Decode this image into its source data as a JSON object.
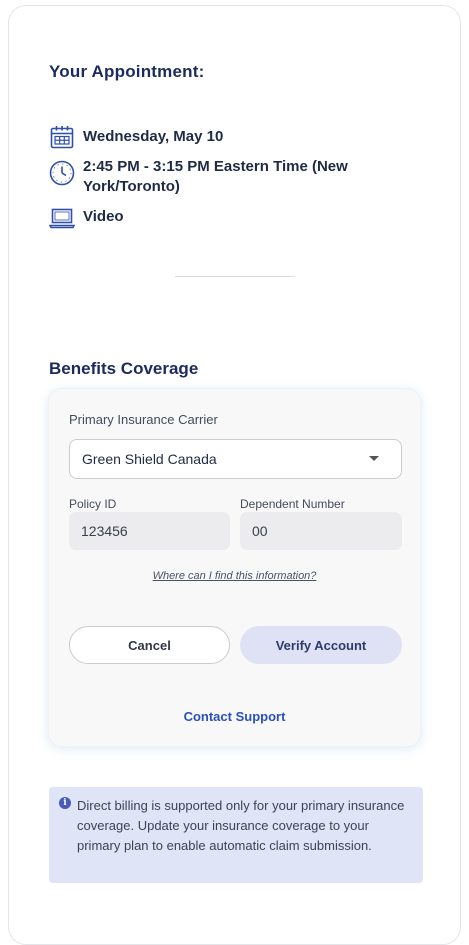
{
  "appointment": {
    "title": "Your Appointment:",
    "date": "Wednesday, May 10",
    "time": "2:45 PM - 3:15 PM Eastern Time (New York/Toronto)",
    "mode": "Video",
    "icons": {
      "date": "calendar-icon",
      "time": "clock-icon",
      "mode": "laptop-icon"
    },
    "accent_color": "#2f4fa8"
  },
  "benefits": {
    "title": "Benefits Coverage",
    "carrier_label": "Primary Insurance Carrier",
    "carrier_value": "Green Shield Canada",
    "policy_label": "Policy ID",
    "policy_value": "123456",
    "dependent_label": "Dependent Number",
    "dependent_value": "00",
    "help_link": "Where can I find this information?",
    "cancel_label": "Cancel",
    "verify_label": "Verify Account",
    "contact_label": "Contact Support"
  },
  "notice": {
    "text": "Direct billing is supported only for your primary insurance coverage. Update your insurance coverage to your primary plan to enable automatic claim submission.",
    "icon": "info-icon",
    "background": "#dfe4f6"
  }
}
